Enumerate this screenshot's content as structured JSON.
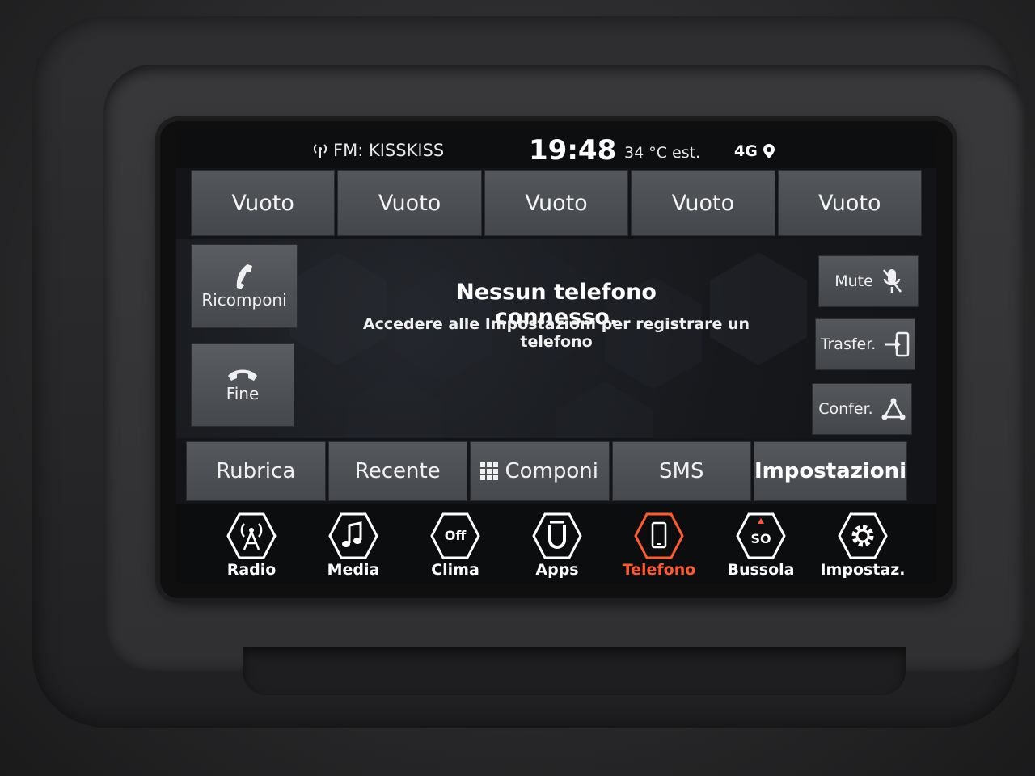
{
  "status": {
    "radio": "FM: KISSKISS",
    "time": "19:48",
    "temperature": "34 °C est.",
    "network": "4G"
  },
  "favorites": [
    "Vuoto",
    "Vuoto",
    "Vuoto",
    "Vuoto",
    "Vuoto"
  ],
  "call_controls": {
    "redial": "Ricomponi",
    "end": "Fine",
    "mute": "Mute",
    "transfer": "Trasfer.",
    "conference": "Confer."
  },
  "message": {
    "title": "Nessun telefono connesso.",
    "subtitle": "Accedere alle Impostazioni per registrare un telefono"
  },
  "tabs": [
    "Rubrica",
    "Recente",
    "Componi",
    "SMS",
    "Impostazioni"
  ],
  "nav": {
    "items": [
      "Radio",
      "Media",
      "Clima",
      "Apps",
      "Telefono",
      "Bussola",
      "Impostaz."
    ],
    "active": "Telefono",
    "clima_badge": "Off",
    "bussola_badge": "SO"
  },
  "colors": {
    "accent": "#ff5a2c",
    "button": "#505358",
    "screen_bg": "#121418"
  }
}
